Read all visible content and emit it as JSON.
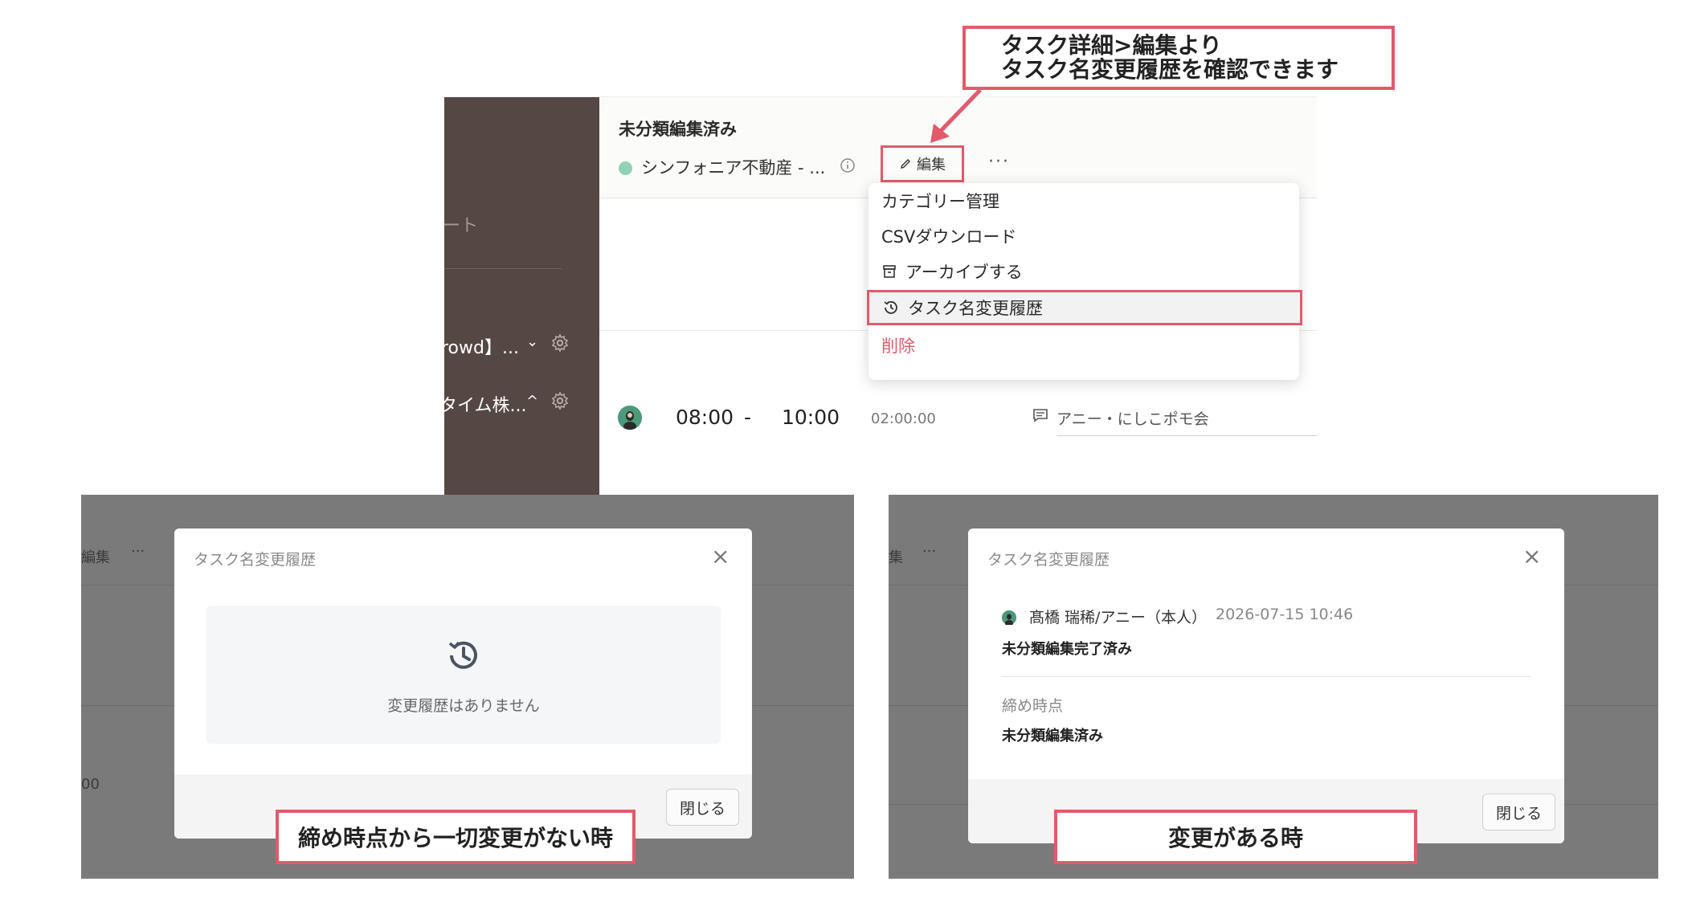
{
  "callout": {
    "line1": "タスク詳細>編集より",
    "line2": "タスク名変更履歴を確認できます"
  },
  "sidebar": {
    "partial_text_1": "ート",
    "project_1": "rowd】...",
    "project_2": "タイム株...",
    "project_1_chevron": "⌄",
    "project_2_chevron": "^"
  },
  "task": {
    "title": "未分類編集済み",
    "org": "シンフォニア不動産 - ...",
    "edit_label": "編集",
    "more_label": "···"
  },
  "menu": {
    "items": [
      {
        "label": "カテゴリー管理",
        "icon": ""
      },
      {
        "label": "CSVダウンロード",
        "icon": ""
      },
      {
        "label": "アーカイブする",
        "icon": "archive-icon"
      },
      {
        "label": "タスク名変更履歴",
        "icon": "history-icon"
      },
      {
        "label": "削除",
        "icon": ""
      }
    ]
  },
  "entry": {
    "start": "08:00",
    "dash": "-",
    "end": "10:00",
    "duration": "02:00:00",
    "comment": "アニー・にしこポモ会"
  },
  "modal_empty": {
    "title": "タスク名変更履歴",
    "close_icon": "×",
    "empty_text": "変更履歴はありません",
    "close_button": "閉じる",
    "bg_edit": "編集",
    "bg_more": "···",
    "bg_time": "00"
  },
  "modal_history": {
    "title": "タスク名変更履歴",
    "close_icon": "×",
    "user": "髙橋 瑞稀/アニー（本人）",
    "timestamp": "2026-07-15 10:46",
    "new_name": "未分類編集完了済み",
    "snapshot_label": "締め時点",
    "old_name": "未分類編集済み",
    "close_button": "閉じる",
    "bg_edit": "集",
    "bg_more": "···"
  },
  "labels": {
    "left": "締め時点から一切変更がない時",
    "right": "変更がある時"
  },
  "colors": {
    "accent_red": "#e25a6b",
    "sidebar_bg": "#554744",
    "overlay_bg": "#7a7a7a",
    "status_green": "#8fd3b4"
  }
}
